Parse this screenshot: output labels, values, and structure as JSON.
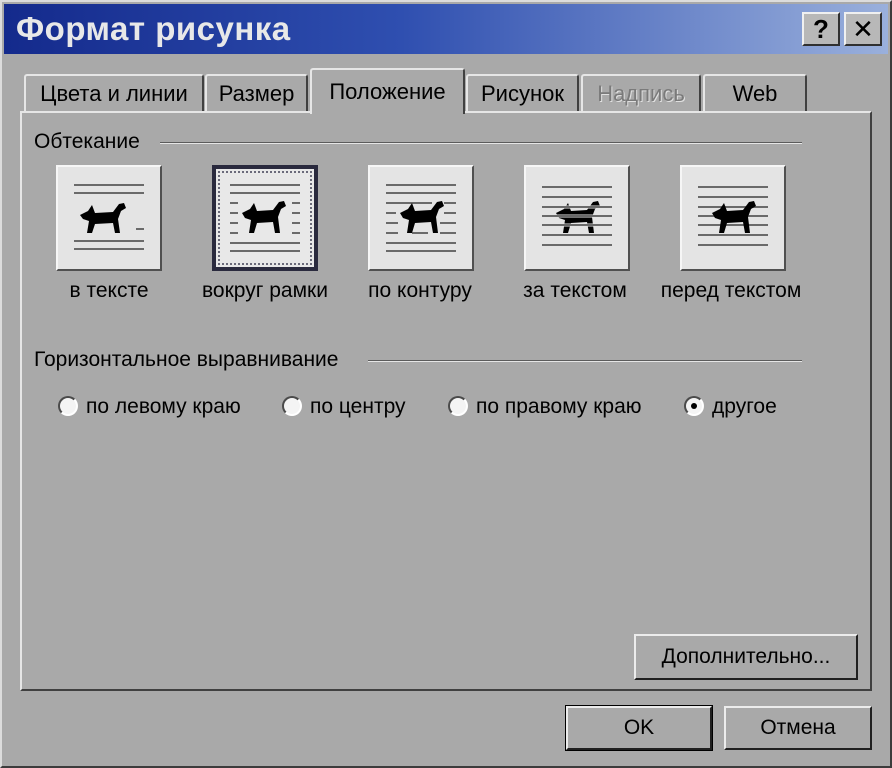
{
  "window": {
    "title": "Формат рисунка",
    "help_label": "?",
    "close_label": "✕"
  },
  "tabs": [
    {
      "label": "Цвета и линии",
      "state": "normal"
    },
    {
      "label": "Размер",
      "state": "normal"
    },
    {
      "label": "Положение",
      "state": "active"
    },
    {
      "label": "Рисунок",
      "state": "normal"
    },
    {
      "label": "Надпись",
      "state": "disabled"
    },
    {
      "label": "Web",
      "state": "normal"
    }
  ],
  "wrapping": {
    "group_label": "Обтекание",
    "options": [
      {
        "label": "в тексте",
        "icon": "inline-with-text-icon",
        "selected": false
      },
      {
        "label": "вокруг рамки",
        "icon": "square-wrap-icon",
        "selected": true
      },
      {
        "label": "по контуру",
        "icon": "tight-wrap-icon",
        "selected": false
      },
      {
        "label": "за текстом",
        "icon": "behind-text-icon",
        "selected": false
      },
      {
        "label": "перед текстом",
        "icon": "in-front-of-text-icon",
        "selected": false
      }
    ]
  },
  "horizontal_alignment": {
    "group_label": "Горизонтальное выравнивание",
    "options": [
      {
        "label": "по левому краю",
        "checked": false
      },
      {
        "label": "по центру",
        "checked": false
      },
      {
        "label": "по правому краю",
        "checked": false
      },
      {
        "label": "другое",
        "checked": true
      }
    ]
  },
  "buttons": {
    "advanced": "Дополнительно...",
    "ok": "OK",
    "cancel": "Отмена"
  }
}
